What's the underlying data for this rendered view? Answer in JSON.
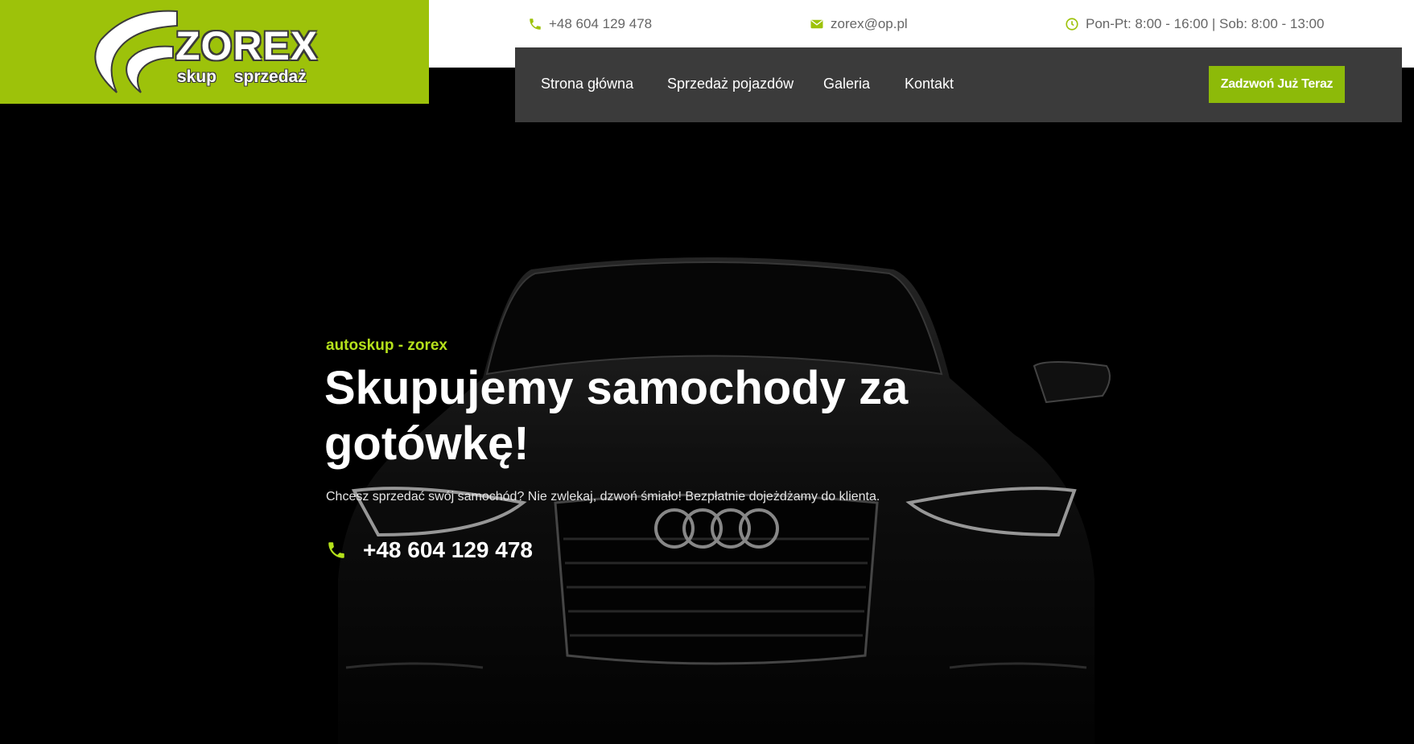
{
  "brand": {
    "name": "ZOREX",
    "tagline": "skup sprzedaż",
    "color": "#9dc20a"
  },
  "topbar": {
    "phone": "+48 604 129 478",
    "email": "zorex@op.pl",
    "hours": "Pon-Pt: 8:00 - 16:00 | Sob: 8:00 - 13:00",
    "icon_color": "#9dc20a"
  },
  "nav": {
    "items": [
      {
        "label": "Strona główna"
      },
      {
        "label": "Sprzedaż pojazdów"
      },
      {
        "label": "Galeria"
      },
      {
        "label": "Kontakt"
      }
    ],
    "cta_label": "Zadzwoń Już Teraz",
    "background": "#3b3b3b"
  },
  "hero": {
    "eyebrow": "autoskup - zorex",
    "headline": "Skupujemy samochody za gotówkę!",
    "lead": "Chcesz sprzedać swój samochód? Nie zwlekaj, dzwoń śmiało! Bezpłatnie dojeżdżamy do klienta.",
    "phone": "+48 604 129 478",
    "accent": "#b5e11b"
  }
}
